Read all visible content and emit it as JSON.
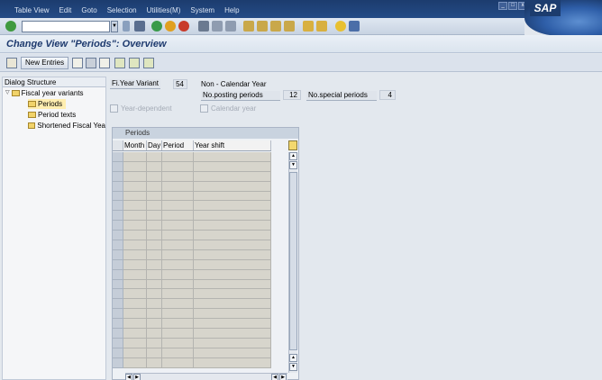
{
  "menu": {
    "items": [
      "Table View",
      "Edit",
      "Goto",
      "Selection",
      "Utilities(M)",
      "System",
      "Help"
    ],
    "window_buttons": [
      "_",
      "□",
      "x"
    ]
  },
  "logo_text": "SAP",
  "command_field": {
    "value": "",
    "dropdown_glyph": "▼"
  },
  "page": {
    "title": "Change View \"Periods\": Overview"
  },
  "app_toolbar": {
    "new_entries_label": "New Entries"
  },
  "dialog_structure": {
    "header": "Dialog Structure",
    "root": "Fiscal year variants",
    "children": [
      "Periods",
      "Period texts",
      "Shortened Fiscal Yea"
    ]
  },
  "form": {
    "fy_variant_label": "Fi.Year Variant",
    "fy_variant_value": "54",
    "fy_variant_desc": "Non - Calendar Year",
    "posting_periods_label": "No.posting periods",
    "posting_periods_value": "12",
    "special_periods_label": "No.special periods",
    "special_periods_value": "4",
    "year_dependent_label": "Year-dependent",
    "calendar_year_label": "Calendar year"
  },
  "periods_table": {
    "title": "Periods",
    "columns": [
      "Month",
      "Day",
      "Period",
      "Year shift"
    ],
    "visible_row_count": 22
  },
  "colors": {
    "menubar": "#1c3c6e",
    "title_text": "#1e3a6e",
    "table_cell": "#d7d5cc",
    "tree_selected": "#ffeeb0"
  }
}
